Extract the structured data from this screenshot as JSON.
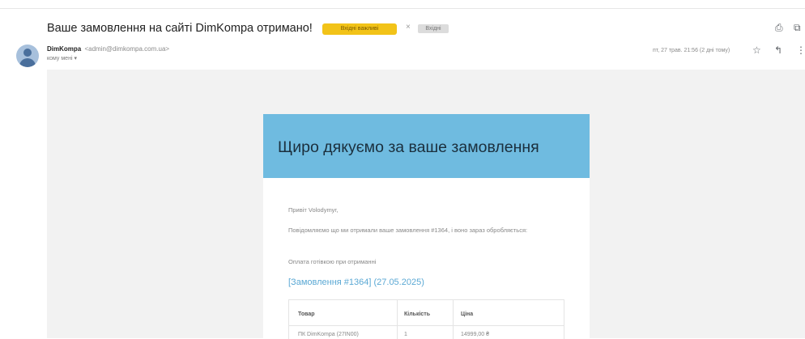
{
  "header": {
    "subject": "Ваше замовлення на сайті DimKompa отримано!",
    "label_badge": "Вхідні важливі",
    "label_chip": "Вхідні",
    "remove_label": "×",
    "print_icon_glyph": "⎙",
    "open_window_icon_glyph": "⧉"
  },
  "sender": {
    "name": "DimKompa",
    "email": "<admin@dimkompa.com.ua>",
    "to_line": "кому мені ▾",
    "date": "пт, 27 трав. 21:56 (2 дні тому)",
    "star_icon_glyph": "☆",
    "reply_icon_glyph": "↰",
    "more_icon_glyph": "⋮"
  },
  "email": {
    "title": "Щиро дякуємо за ваше замовлення",
    "greeting": "Привіт Volodymyr,",
    "notice": "Повідомляємо що ми отримали ваше замовлення #1364, і воно зараз обробляється:",
    "payment": "Оплата готівкою при отриманні",
    "order_link": "[Замовлення #1364] (27.05.2025)",
    "table": {
      "headers": [
        "Товар",
        "Кількість",
        "Ціна"
      ],
      "row": [
        "ПК DimKompa (27IN00)",
        "1",
        "14999,00 ₴"
      ]
    }
  },
  "colors": {
    "header_bg": "#6fbbe0",
    "link": "#5aa8d4",
    "badge": "#f2c318"
  }
}
